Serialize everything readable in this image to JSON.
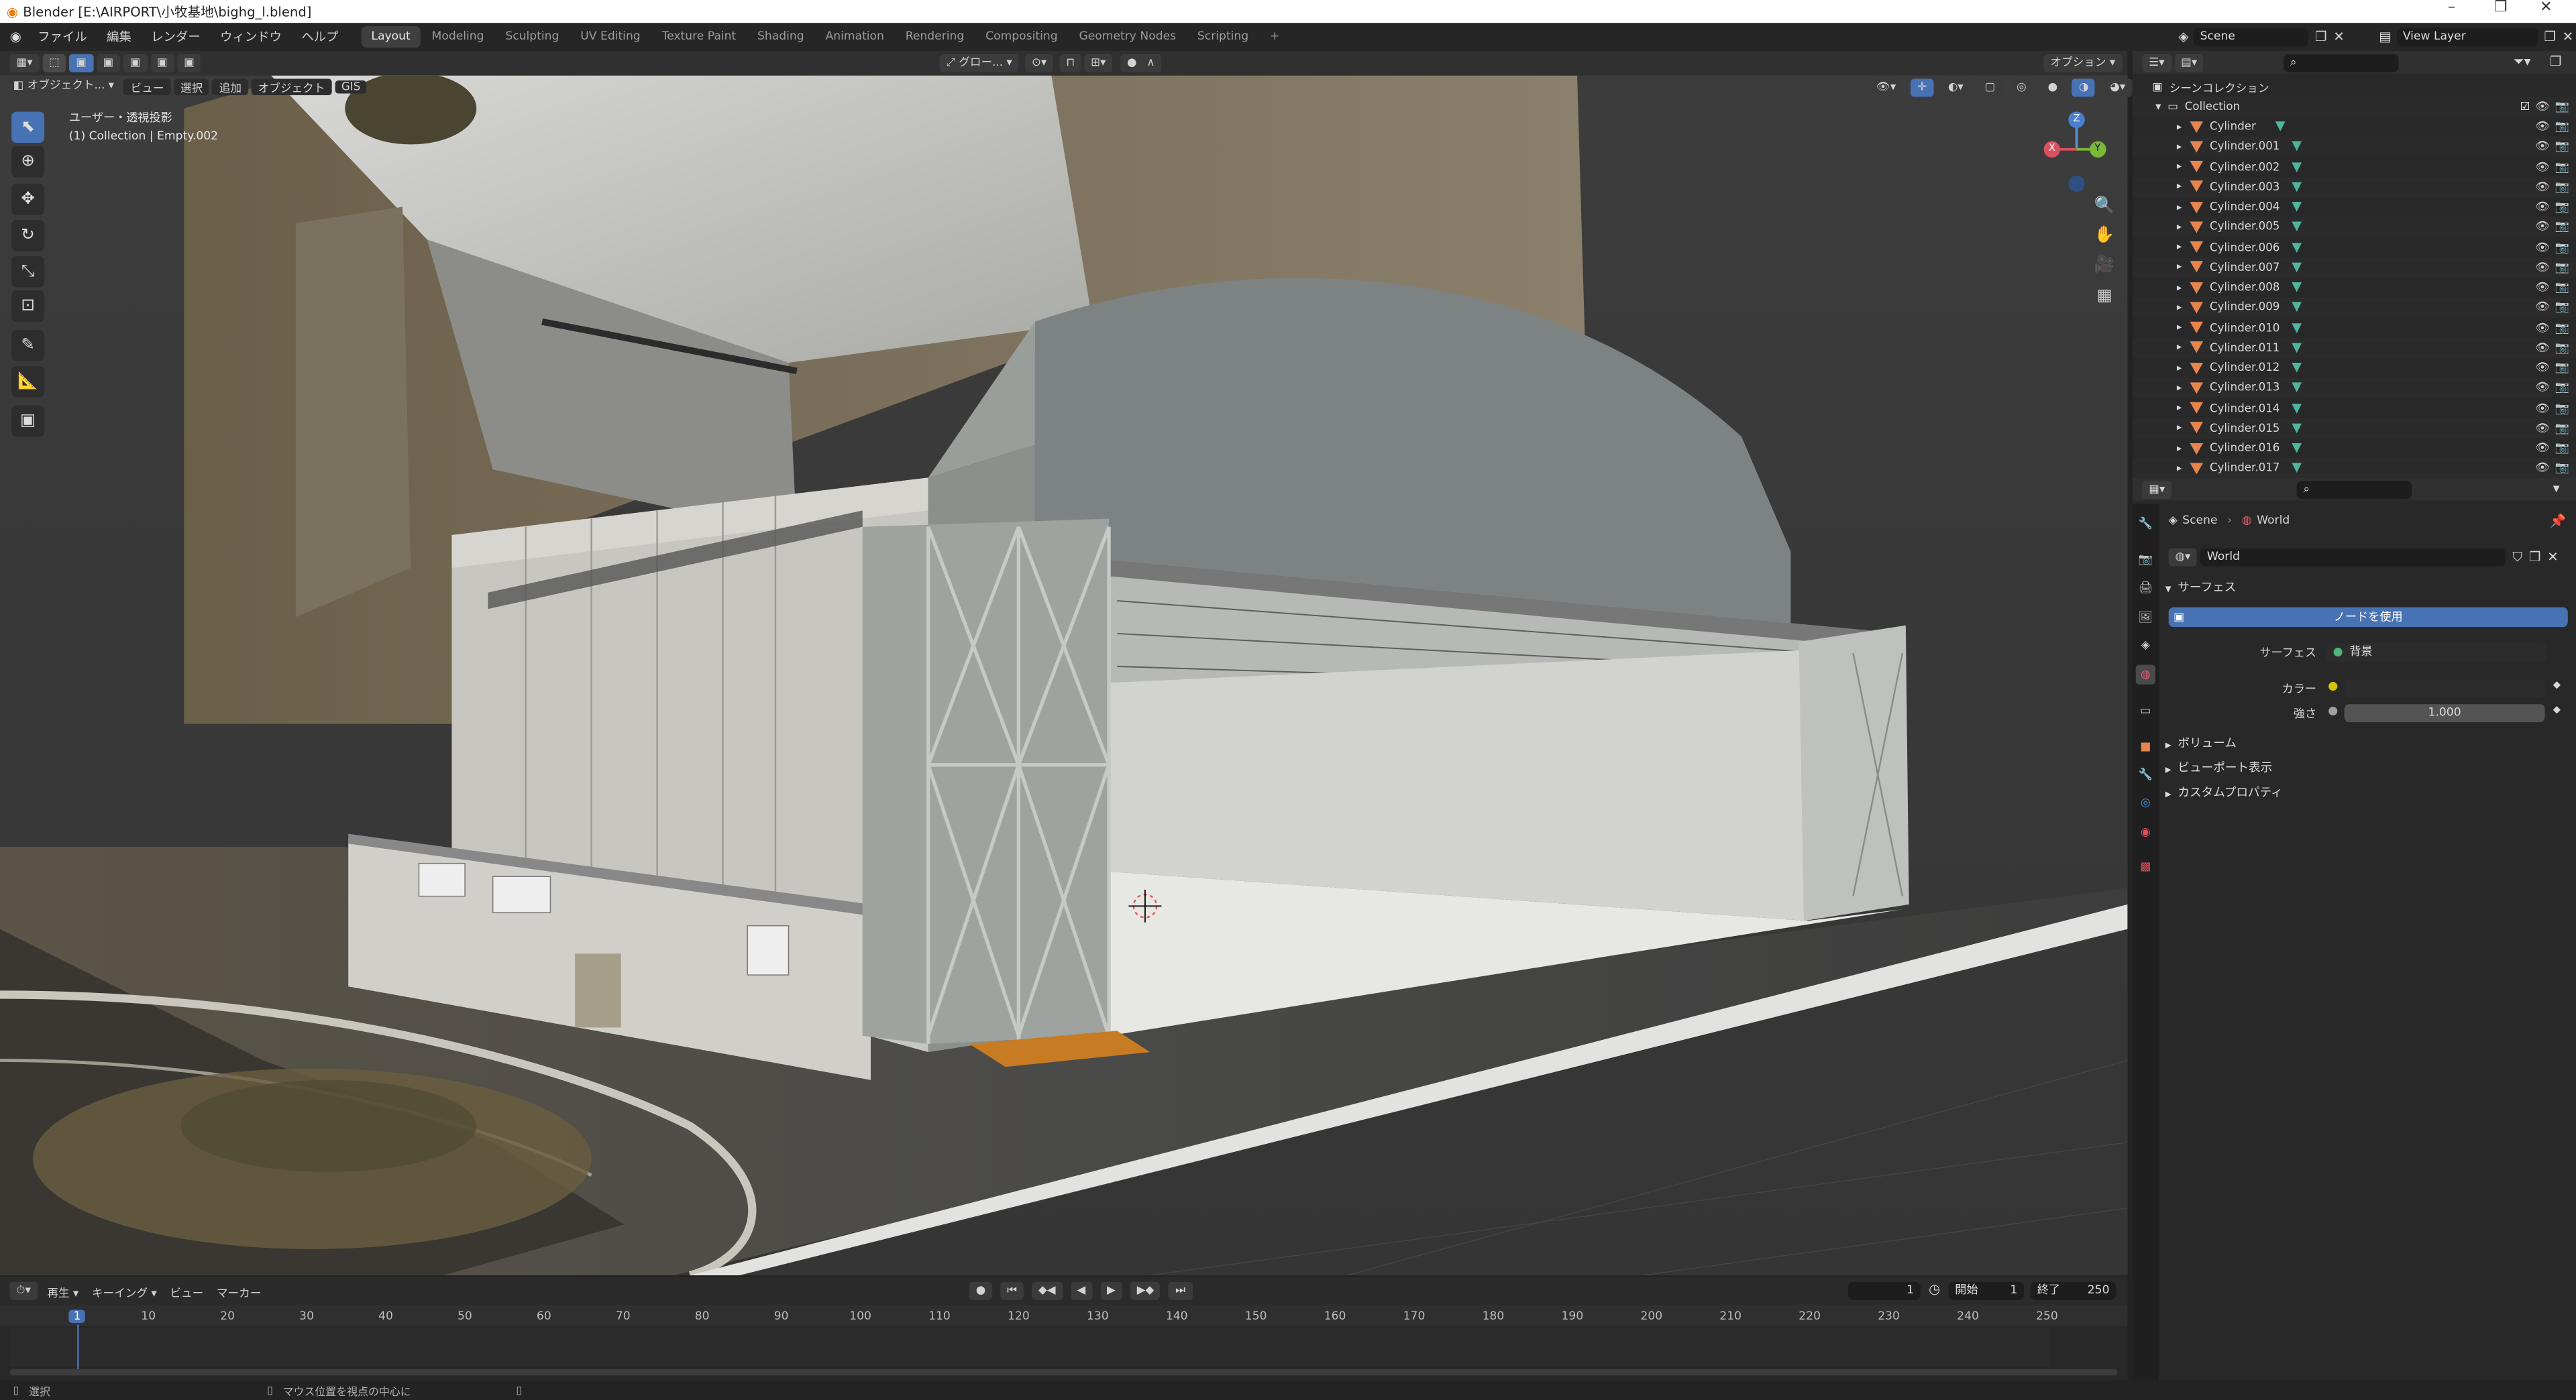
{
  "window": {
    "title": "Blender [E:\\AIRPORT\\小牧基地\\bighg_l.blend]",
    "minimize": "–",
    "maximize": "❐",
    "close": "✕"
  },
  "menu": {
    "items": [
      "ファイル",
      "編集",
      "レンダー",
      "ウィンドウ",
      "ヘルプ"
    ]
  },
  "workspaces": [
    "Layout",
    "Modeling",
    "Sculpting",
    "UV Editing",
    "Texture Paint",
    "Shading",
    "Animation",
    "Rendering",
    "Compositing",
    "Geometry Nodes",
    "Scripting"
  ],
  "scene": {
    "name": "Scene",
    "view_layer": "View Layer"
  },
  "viewport": {
    "mode": "オブジェクト...",
    "menus": [
      "ビュー",
      "選択",
      "追加",
      "オブジェクト",
      "GIS"
    ],
    "transform_orientation": "グロー...",
    "options_label": "オプション",
    "info_line1": "ユーザー・透視投影",
    "info_line2": "(1) Collection | Empty.002",
    "gizmo": {
      "x": "X",
      "y": "Y",
      "z": "Z"
    }
  },
  "timeline": {
    "menus": [
      "再生",
      "キーイング",
      "ビュー",
      "マーカー"
    ],
    "current_frame": "1",
    "start_label": "開始",
    "start": "1",
    "end_label": "終了",
    "end": "250",
    "ticks": [
      "1",
      "10",
      "20",
      "30",
      "40",
      "50",
      "60",
      "70",
      "80",
      "90",
      "100",
      "110",
      "120",
      "130",
      "140",
      "150",
      "160",
      "170",
      "180",
      "190",
      "200",
      "210",
      "220",
      "230",
      "240",
      "250"
    ]
  },
  "status": {
    "left": "選択",
    "middle": "マウス位置を視点の中心に"
  },
  "outliner": {
    "root": "シーンコレクション",
    "collection": "Collection",
    "items": [
      "Cylinder",
      "Cylinder.001",
      "Cylinder.002",
      "Cylinder.003",
      "Cylinder.004",
      "Cylinder.005",
      "Cylinder.006",
      "Cylinder.007",
      "Cylinder.008",
      "Cylinder.009",
      "Cylinder.010",
      "Cylinder.011",
      "Cylinder.012",
      "Cylinder.013",
      "Cylinder.014",
      "Cylinder.015",
      "Cylinder.016",
      "Cylinder.017"
    ]
  },
  "properties": {
    "breadcrumb_scene": "Scene",
    "breadcrumb_world": "World",
    "world_name": "World",
    "surface_panel": "サーフェス",
    "use_nodes": "ノードを使用",
    "surface_label": "サーフェス",
    "surface_value": "背景",
    "color_label": "カラー",
    "strength_label": "強さ",
    "strength_value": "1.000",
    "volume_panel": "ボリューム",
    "viewport_panel": "ビューポート表示",
    "custom_panel": "カスタムプロパティ"
  },
  "colors": {
    "accent": "#4772b3",
    "object": "#e8844e",
    "mesh": "#4fb59c"
  }
}
